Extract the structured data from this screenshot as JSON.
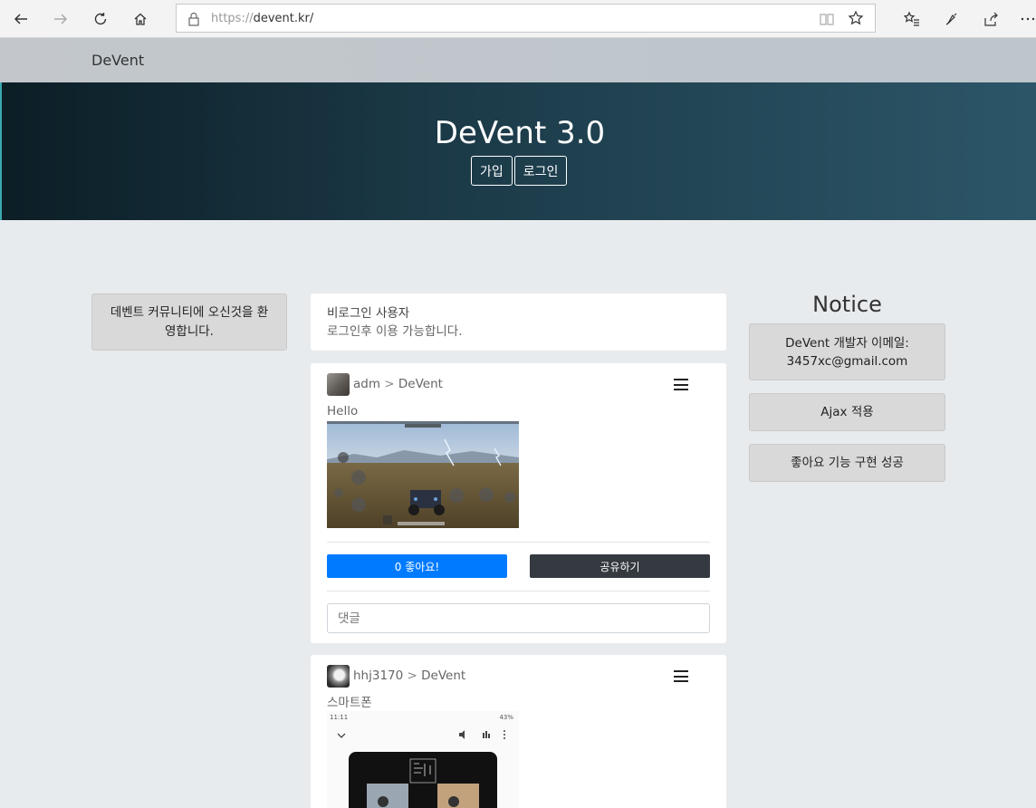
{
  "browser": {
    "url_prefix": "https://",
    "url_host": "devent.kr/"
  },
  "site": {
    "brand": "DeVent"
  },
  "hero": {
    "title": "DeVent 3.0",
    "signup_label": "가입",
    "login_label": "로그인"
  },
  "welcome": {
    "text": "데벤트 커뮤니티에 오신것을 환영합니다."
  },
  "info": {
    "title": "비로그인 사용자",
    "subtitle": "로그인후 이용 가능합니다."
  },
  "posts": [
    {
      "author": "adm",
      "separator": ">",
      "board": "DeVent",
      "text": "Hello",
      "like_label": "0 좋아요!",
      "share_label": "공유하기",
      "comment_placeholder": "댓글"
    },
    {
      "author": "hhj3170",
      "separator": ">",
      "board": "DeVent",
      "text": "스마트폰",
      "phone_time": "11:11",
      "phone_battery": "43%"
    }
  ],
  "notice": {
    "title": "Notice",
    "items": [
      "DeVent 개발자 이메일: 3457xc@gmail.com",
      "Ajax 적용",
      "좋아요 기능 구현 성공"
    ]
  },
  "colors": {
    "like": "#007bff",
    "share": "#343a40",
    "hero_start": "#0c1e26",
    "hero_end": "#2c5668"
  }
}
